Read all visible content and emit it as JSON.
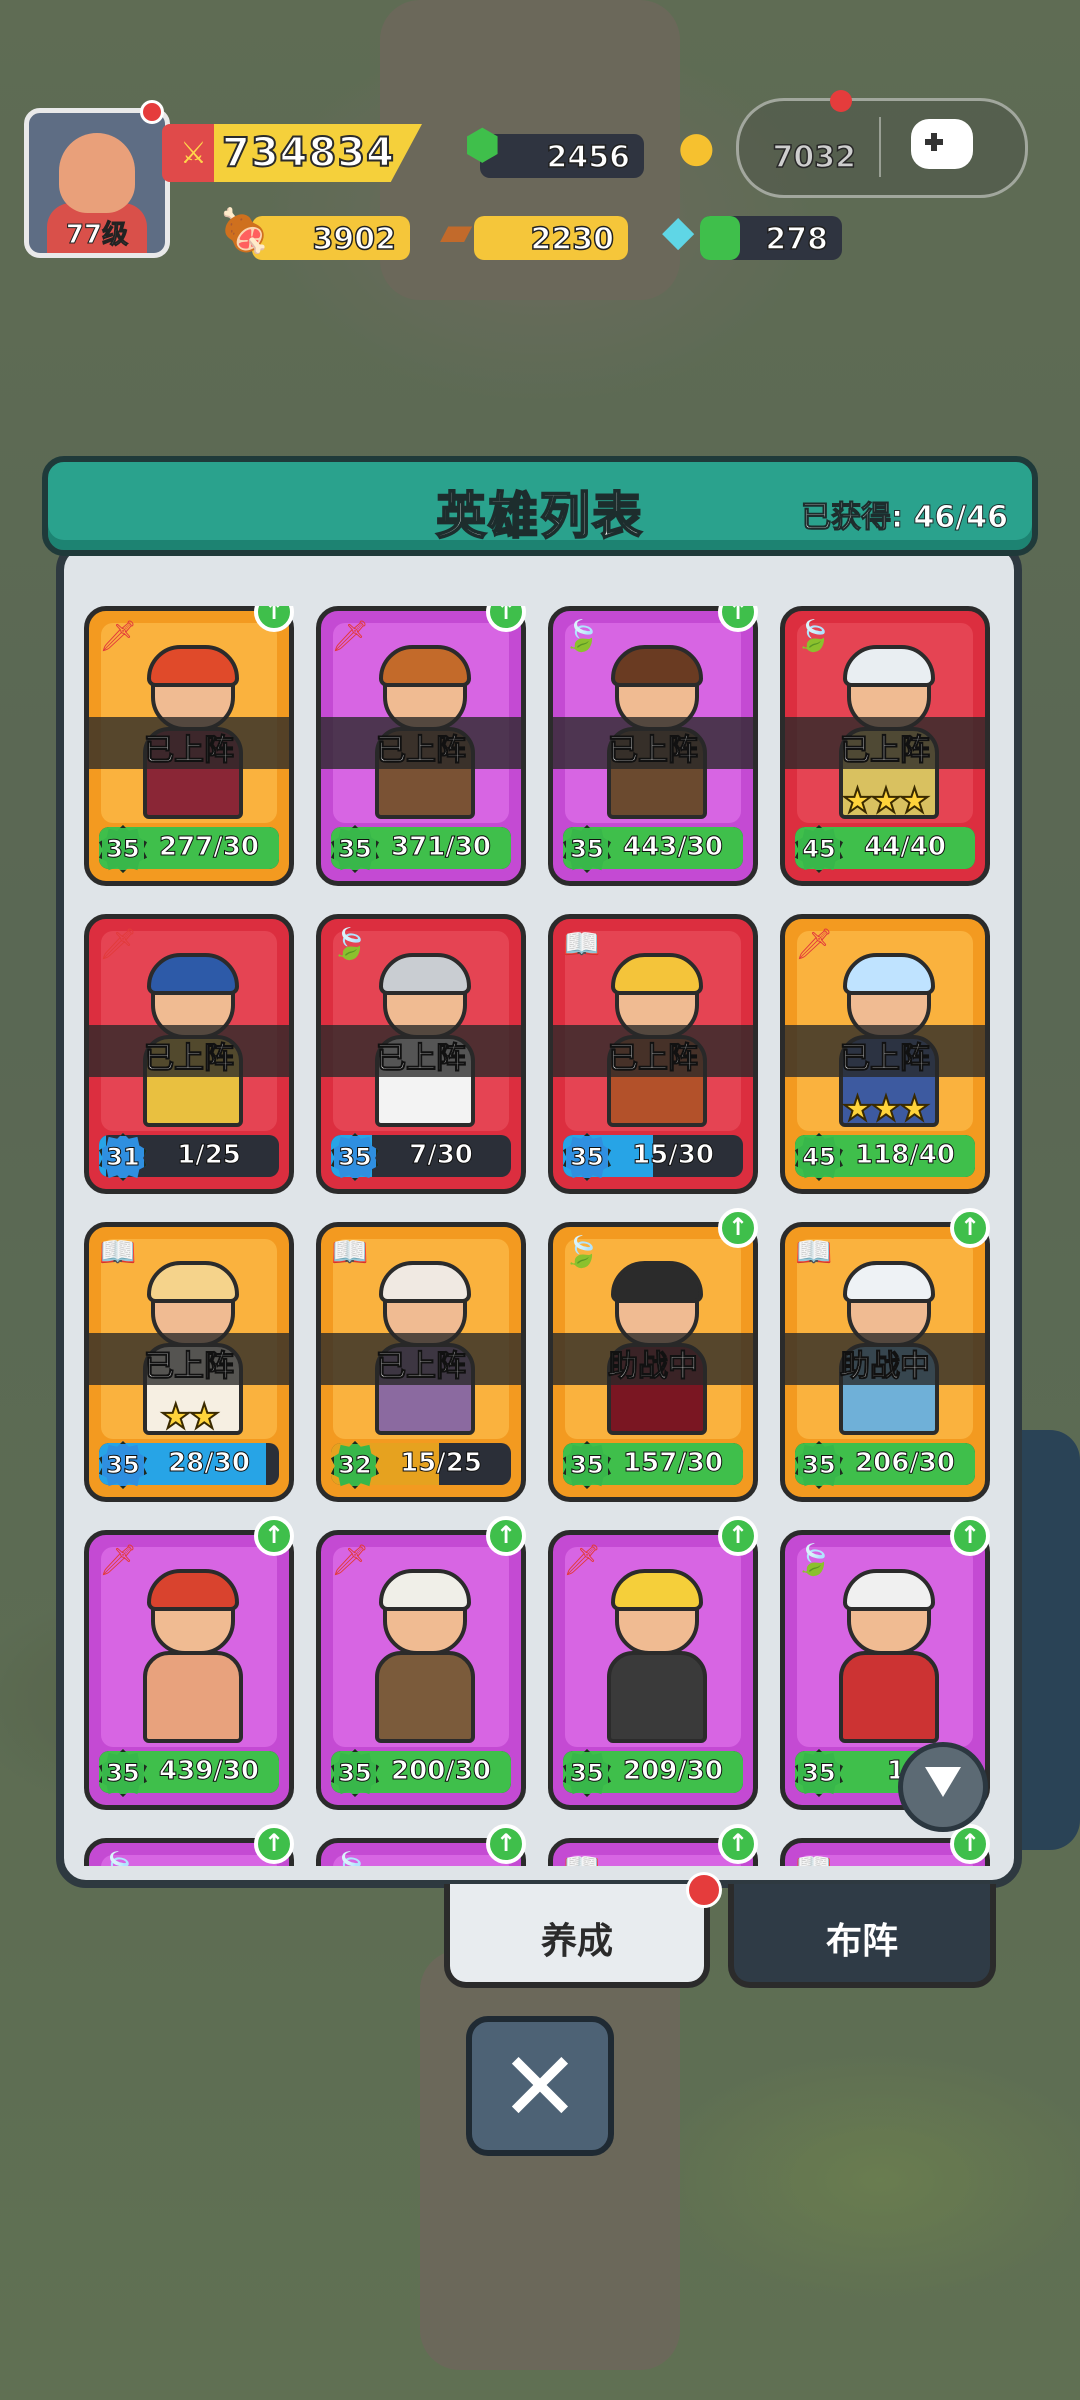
{
  "hud": {
    "level": "77级",
    "power": "734834",
    "resources": {
      "gems": "2456",
      "gold": "7032",
      "meat": "3902",
      "wood": "2230",
      "crystal": "278"
    }
  },
  "panel": {
    "title": "英雄列表",
    "owned_label": "已获得: 46/46"
  },
  "heroes": [
    {
      "status": "已上阵",
      "level": "35",
      "progress": "277/30",
      "rarity": "orange",
      "class": "dagger",
      "upgrade": true,
      "stars": 0,
      "fill": 1.0,
      "barColor": "#3fbf4b",
      "hair": "#e04a2a",
      "body": "#8a2636"
    },
    {
      "status": "已上阵",
      "level": "35",
      "progress": "371/30",
      "rarity": "purple",
      "class": "dagger",
      "upgrade": true,
      "stars": 0,
      "fill": 1.0,
      "barColor": "#3fbf4b",
      "hair": "#c36a2a",
      "body": "#7a5234"
    },
    {
      "status": "已上阵",
      "level": "35",
      "progress": "443/30",
      "rarity": "purple",
      "class": "leaf",
      "upgrade": true,
      "stars": 0,
      "fill": 1.0,
      "barColor": "#3fbf4b",
      "hair": "#6a3b22",
      "body": "#6b4a2f"
    },
    {
      "status": "已上阵",
      "level": "45",
      "progress": "44/40",
      "rarity": "red",
      "class": "leaf",
      "upgrade": false,
      "stars": 3,
      "fill": 1.0,
      "barColor": "#3fbf4b",
      "hair": "#e9eef2",
      "body": "#d9c160"
    },
    {
      "status": "已上阵",
      "level": "31",
      "progress": "1/25",
      "rarity": "red",
      "class": "dagger",
      "upgrade": false,
      "stars": 0,
      "fill": 0.04,
      "barColor": "#27a4e6",
      "hair": "#2d5aa8",
      "body": "#e9c040"
    },
    {
      "status": "已上阵",
      "level": "35",
      "progress": "7/30",
      "rarity": "red",
      "class": "leaf",
      "upgrade": false,
      "stars": 0,
      "fill": 0.23,
      "barColor": "#27a4e6",
      "hair": "#c9cdd2",
      "body": "#f3f3f3"
    },
    {
      "status": "已上阵",
      "level": "35",
      "progress": "15/30",
      "rarity": "red",
      "class": "book",
      "upgrade": false,
      "stars": 0,
      "fill": 0.5,
      "barColor": "#27a4e6",
      "hair": "#f4c43a",
      "body": "#b3512a"
    },
    {
      "status": "已上阵",
      "level": "45",
      "progress": "118/40",
      "rarity": "orange",
      "class": "dagger",
      "upgrade": false,
      "stars": 3,
      "fill": 1.0,
      "barColor": "#3fbf4b",
      "hair": "#bfe3ff",
      "body": "#3d5aa0"
    },
    {
      "status": "已上阵",
      "level": "35",
      "progress": "28/30",
      "rarity": "orange",
      "class": "book",
      "upgrade": false,
      "stars": 2,
      "fill": 0.93,
      "barColor": "#27a4e6",
      "hair": "#f5d38b",
      "body": "#f6efe2"
    },
    {
      "status": "已上阵",
      "level": "32",
      "progress": "15/25",
      "rarity": "orange",
      "class": "book",
      "upgrade": false,
      "stars": 0,
      "fill": 0.6,
      "barColor": "#e6a21f",
      "hair": "#f0e9e2",
      "body": "#8b6aa0"
    },
    {
      "status": "助战中",
      "level": "35",
      "progress": "157/30",
      "rarity": "orange",
      "class": "leaf",
      "upgrade": true,
      "stars": 0,
      "fill": 1.0,
      "barColor": "#3fbf4b",
      "hair": "#2b2b2b",
      "body": "#7a1622"
    },
    {
      "status": "助战中",
      "level": "35",
      "progress": "206/30",
      "rarity": "orange",
      "class": "book",
      "upgrade": true,
      "stars": 0,
      "fill": 1.0,
      "barColor": "#3fbf4b",
      "hair": "#eef2f5",
      "body": "#6fb0d8"
    },
    {
      "status": "",
      "level": "35",
      "progress": "439/30",
      "rarity": "purple",
      "class": "dagger",
      "upgrade": true,
      "stars": 0,
      "fill": 1.0,
      "barColor": "#3fbf4b",
      "hair": "#d9432e",
      "body": "#e8a27d"
    },
    {
      "status": "",
      "level": "35",
      "progress": "200/30",
      "rarity": "purple",
      "class": "dagger",
      "upgrade": true,
      "stars": 0,
      "fill": 1.0,
      "barColor": "#3fbf4b",
      "hair": "#f0efe8",
      "body": "#7b5b3b"
    },
    {
      "status": "",
      "level": "35",
      "progress": "209/30",
      "rarity": "purple",
      "class": "dagger",
      "upgrade": true,
      "stars": 0,
      "fill": 1.0,
      "barColor": "#3fbf4b",
      "hair": "#f5cf3a",
      "body": "#3a3a3a"
    },
    {
      "status": "",
      "level": "35",
      "progress": "19",
      "rarity": "purple",
      "class": "leaf",
      "upgrade": true,
      "stars": 0,
      "fill": 1.0,
      "barColor": "#3fbf4b",
      "hair": "#f0f0f0",
      "body": "#c33"
    },
    {
      "status": "",
      "level": "",
      "progress": "",
      "rarity": "purple",
      "class": "leaf",
      "upgrade": true,
      "stars": 0,
      "fill": 0,
      "barColor": "#3fbf4b",
      "hair": "#888",
      "body": "#888"
    },
    {
      "status": "",
      "level": "",
      "progress": "",
      "rarity": "purple",
      "class": "leaf",
      "upgrade": true,
      "stars": 0,
      "fill": 0,
      "barColor": "#3fbf4b",
      "hair": "#888",
      "body": "#888"
    },
    {
      "status": "",
      "level": "",
      "progress": "",
      "rarity": "purple",
      "class": "book",
      "upgrade": true,
      "stars": 0,
      "fill": 0,
      "barColor": "#3fbf4b",
      "hair": "#888",
      "body": "#888"
    },
    {
      "status": "",
      "level": "",
      "progress": "",
      "rarity": "purple",
      "class": "book",
      "upgrade": true,
      "stars": 0,
      "fill": 0,
      "barColor": "#3fbf4b",
      "hair": "#888",
      "body": "#888"
    }
  ],
  "tabs": {
    "train": "养成",
    "formation": "布阵"
  },
  "icons": {
    "close": "close-icon",
    "filter": "filter-icon",
    "controller": "gamepad-icon"
  }
}
